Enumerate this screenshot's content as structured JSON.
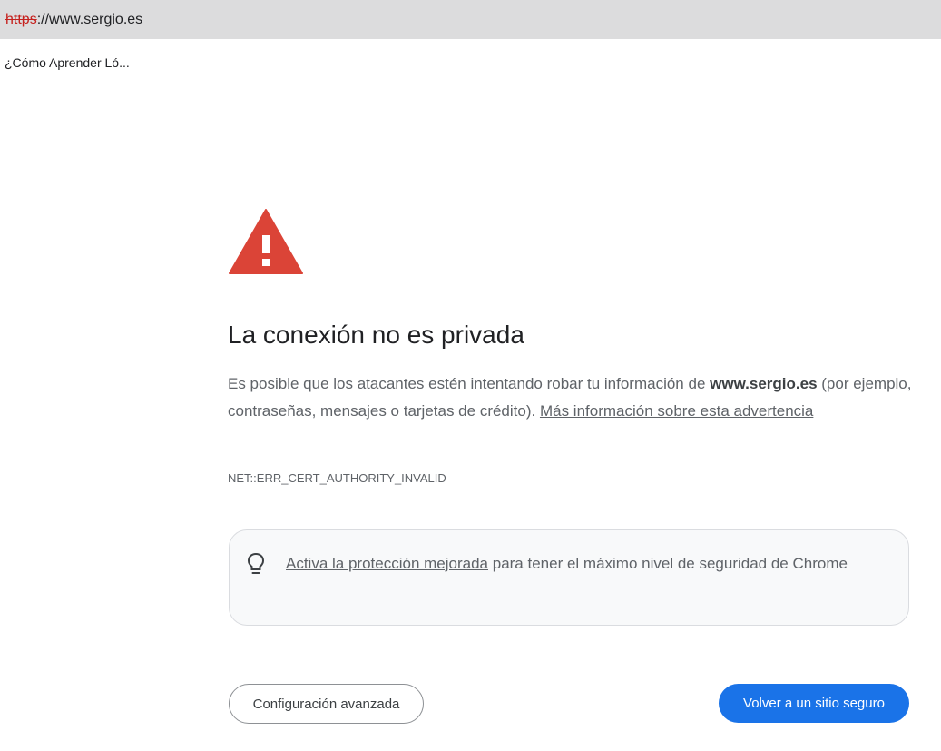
{
  "browser": {
    "url_scheme": "https",
    "url_rest": "://www.sergio.es",
    "tab_title": "¿Cómo Aprender Ló..."
  },
  "error_page": {
    "icon": "warning-triangle-icon",
    "heading": "La conexión no es privada",
    "body_before": "Es posible que los atacantes estén intentando robar tu información de ",
    "body_domain": "www.sergio.es",
    "body_after": " (por ejemplo, contraseñas, mensajes o tarjetas de crédito). ",
    "learn_more_link": "Más información sobre esta advertencia",
    "error_code": "NET::ERR_CERT_AUTHORITY_INVALID",
    "promo": {
      "icon": "lightbulb-icon",
      "link": "Activa la protección mejorada",
      "text": " para tener el máximo nivel de seguridad de Chrome"
    },
    "advanced_button": "Configuración avanzada",
    "back_button": "Volver a un sitio seguro"
  },
  "colors": {
    "warning_red": "#db4437",
    "primary_blue": "#1a73e8",
    "url_bar_bg": "#dcdcdd"
  }
}
